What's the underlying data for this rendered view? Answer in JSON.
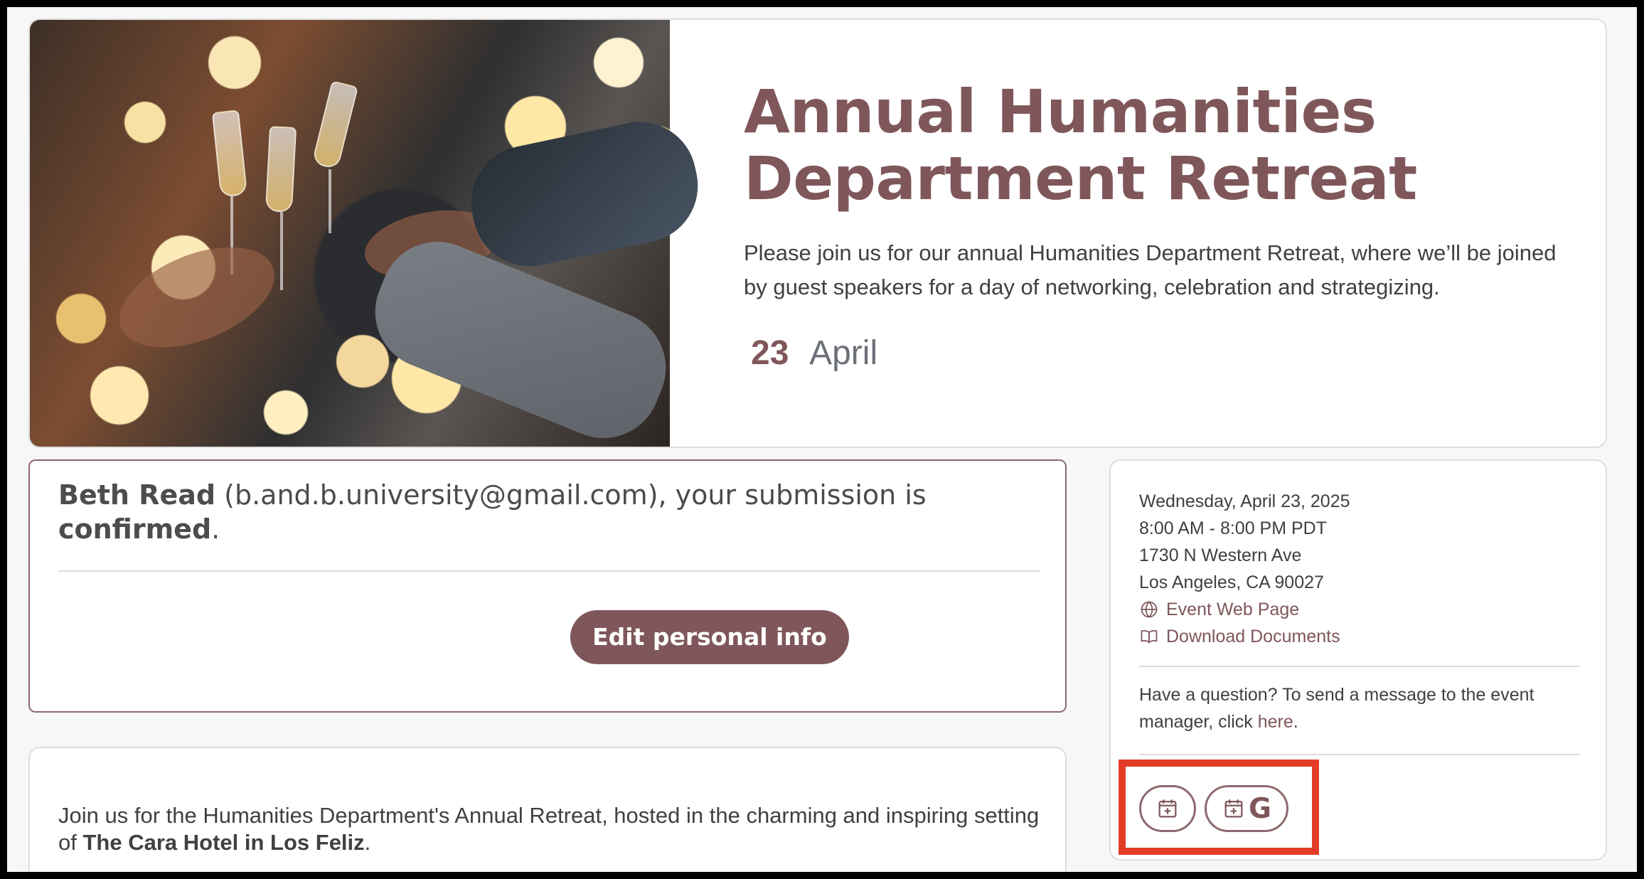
{
  "hero": {
    "title": "Annual Humanities Department Retreat",
    "description": "Please join us for our annual Humanities Department Retreat, where we’ll be joined by guest speakers for a day of networking, celebration and strategizing.",
    "date_day": "23",
    "date_month": "April"
  },
  "confirmation": {
    "name": "Beth Read",
    "email": "(b.and.b.university@gmail.com), your submission is",
    "status": "confirmed",
    "edit_label": "Edit personal info"
  },
  "event_info": {
    "date": "Wednesday, April 23, 2025",
    "time": "8:00 AM - 8:00 PM PDT",
    "address_line1": "1730 N Western Ave",
    "address_line2": "Los Angeles, CA 90027",
    "web_page": "Event Web Page",
    "documents": "Download Documents",
    "question_prefix": "Have a question? To send a message to the event manager, click",
    "question_link": "here",
    "question_suffix": "."
  },
  "about": {
    "text_prefix": "Join us for the Humanities Department's Annual Retreat, hosted in the charming and inspiring setting of",
    "venue": "The Cara Hotel in Los Feliz",
    "text_suffix": "."
  },
  "calendar_buttons": {
    "google_label": "G"
  },
  "colors": {
    "accent": "#7f575a",
    "highlight": "#e33d27"
  },
  "icons": {
    "web": "globe-icon",
    "documents": "book-icon",
    "calendar": "calendar-add-icon",
    "google_calendar": "google-calendar-icon"
  }
}
